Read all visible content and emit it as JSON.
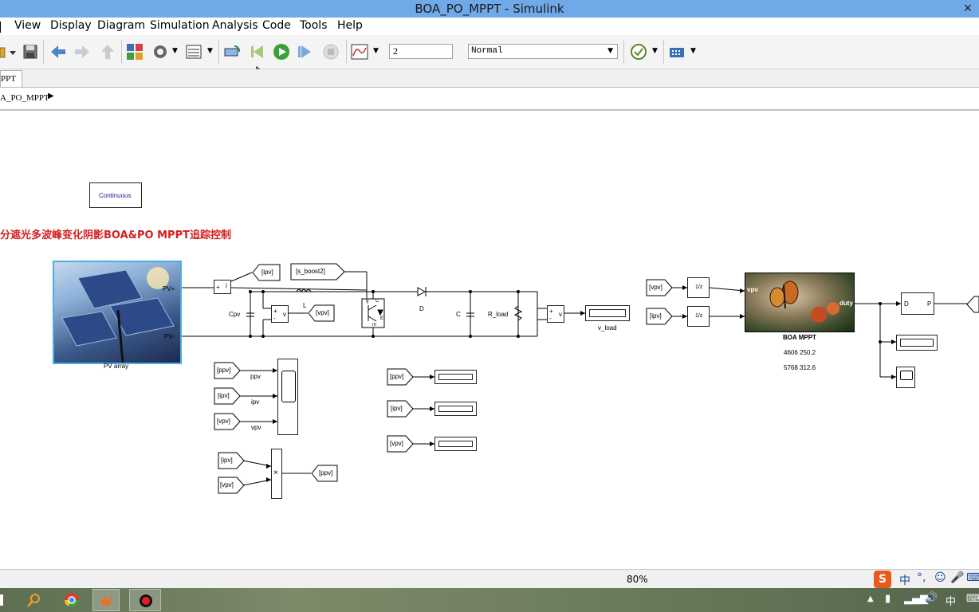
{
  "window": {
    "title": "BOA_PO_MPPT - Simulink",
    "close_label": "✕"
  },
  "menu": [
    "View",
    "Display",
    "Diagram",
    "Simulation",
    "Analysis",
    "Code",
    "Tools",
    "Help"
  ],
  "toolbar": {
    "stop_time": "2",
    "sim_mode": "Normal"
  },
  "tab_label": "PPT",
  "breadcrumb": "A_PO_MPPT",
  "diagram": {
    "continuous_label": "Continuous",
    "title": "分遮光多波峰变化阴影BOA&PO MPPT追踪控制",
    "pv_array_label": "PV array",
    "pv_plus": "PV+",
    "pv_minus": "PV-",
    "goto_ipv": "[ipv]",
    "goto_sboost": "[s_boost2]",
    "goto_vpv": "[vpv]",
    "goto_ppv": "[ppv]",
    "cpv": "Cpv",
    "inductor": "L",
    "diode": "D",
    "capacitor": "C",
    "r_load": "R_load",
    "v_load": "v_load",
    "scope_ppv": "ppv",
    "scope_ipv": "ipv",
    "scope_vpv": "vpv",
    "boa_title": "BOA MPPT",
    "boa_in": "vpv",
    "boa_out": "duty",
    "boa_line1": "4606 250.2",
    "boa_line2": "5768 312.6",
    "pwm_d": "D",
    "pwm_p": "P",
    "delay": "1/z",
    "mult": "×",
    "igbt_g": "g",
    "igbt_c": "C",
    "igbt_m": "m",
    "igbt_e": "E"
  },
  "status": {
    "zoom": "80%"
  },
  "ime": {
    "lang": "中",
    "taskbar_lang": "中"
  },
  "colors": {
    "title_red": "#d42020",
    "titlebar": "#6fa9e8"
  }
}
